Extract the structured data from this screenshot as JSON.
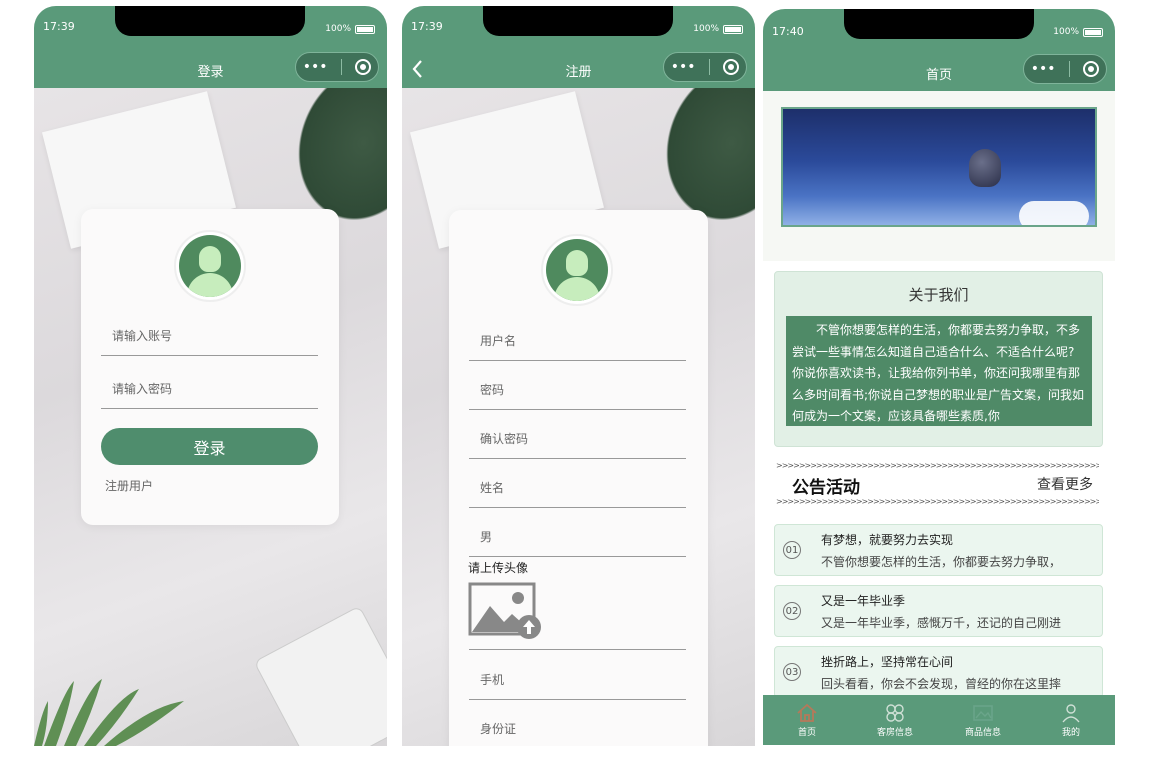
{
  "login": {
    "time": "17:39",
    "battery": "100%",
    "title": "登录",
    "capsule_dots": "•••",
    "account_placeholder": "请输入账号",
    "password_placeholder": "请输入密码",
    "login_button": "登录",
    "register_link": "注册用户"
  },
  "register": {
    "time": "17:39",
    "battery": "100%",
    "title": "注册",
    "back": "<",
    "capsule_dots": "•••",
    "fields": [
      "用户名",
      "密码",
      "确认密码",
      "姓名",
      "男"
    ],
    "upload_label": "请上传头像",
    "fields_after": [
      "手机",
      "身份证"
    ]
  },
  "home": {
    "time": "17:40",
    "battery": "100%",
    "title": "首页",
    "capsule_dots": "•••",
    "about_title": "关于我们",
    "about_text": "不管你想要怎样的生活，你都要去努力争取，不多尝试一些事情怎么知道自己适合什么、不适合什么呢? 你说你喜欢读书，让我给你列书单，你还问我哪里有那么多时间看书;你说自己梦想的职业是广告文案，问我如何成为一个文案，应该具备哪些素质,你",
    "arrows": ">>>>>>>>>>>>>>>>>>>>>>>>>>>>>>>>>>>>>>>>>>>>>>>>>>>>>>>>>>>>>>>>>>>",
    "notice_title": "公告活动",
    "more": "查看更多",
    "notices": [
      {
        "num": "01",
        "title": "有梦想，就要努力去实现",
        "desc": "不管你想要怎样的生活，你都要去努力争取，"
      },
      {
        "num": "02",
        "title": "又是一年毕业季",
        "desc": "又是一年毕业季，感慨万千，还记的自己刚进"
      },
      {
        "num": "03",
        "title": "挫折路上，坚持常在心间",
        "desc": "回头看看，你会不会发现，曾经的你在这里摔"
      }
    ],
    "tabs": [
      "首页",
      "客房信息",
      "商品信息",
      "我的"
    ],
    "colors": {
      "primary": "#5a9a7a",
      "active_tab_icon": "#b5795a"
    }
  }
}
